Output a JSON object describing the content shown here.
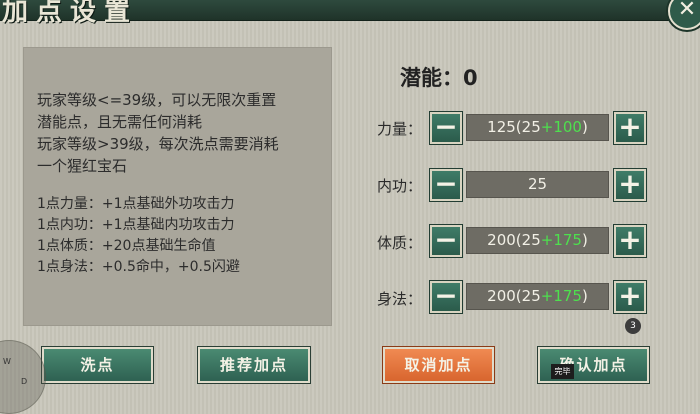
{
  "window": {
    "title": "加点设置"
  },
  "info": {
    "lines": [
      "玩家等级<=39级，可以无限次重置",
      "潜能点，且无需任何消耗",
      "玩家等级>39级，每次洗点需要消耗",
      "一个猩红宝石",
      "1点力量：+1点基础外功攻击力",
      "1点内功：+1点基础内功攻击力",
      "1点体质：+20点基础生命值",
      "1点身法：+0.5命中，+0.5闪避"
    ]
  },
  "potential": {
    "label": "潜能：",
    "value": "0"
  },
  "stats": [
    {
      "label": "力量：",
      "base": "125(25",
      "bonus": "+100",
      "close": ")"
    },
    {
      "label": "内功：",
      "base": "25",
      "bonus": "",
      "close": ""
    },
    {
      "label": "体质：",
      "base": "200(25",
      "bonus": "+175",
      "close": ")"
    },
    {
      "label": "身法：",
      "base": "200(25",
      "bonus": "+175",
      "close": ")"
    }
  ],
  "controls": {
    "minus": "−",
    "plus": "+",
    "close": "✕"
  },
  "badge": "3",
  "buttons": {
    "wash": "洗点",
    "recommend": "推荐加点",
    "cancel": "取消加点",
    "confirm": "确认加点"
  },
  "joystick": {
    "w": "W",
    "d": "D"
  },
  "toast": "完毕",
  "colors": {
    "accent": "#2e6152",
    "cancel": "#e4733c",
    "bonus": "#4ee04e"
  }
}
